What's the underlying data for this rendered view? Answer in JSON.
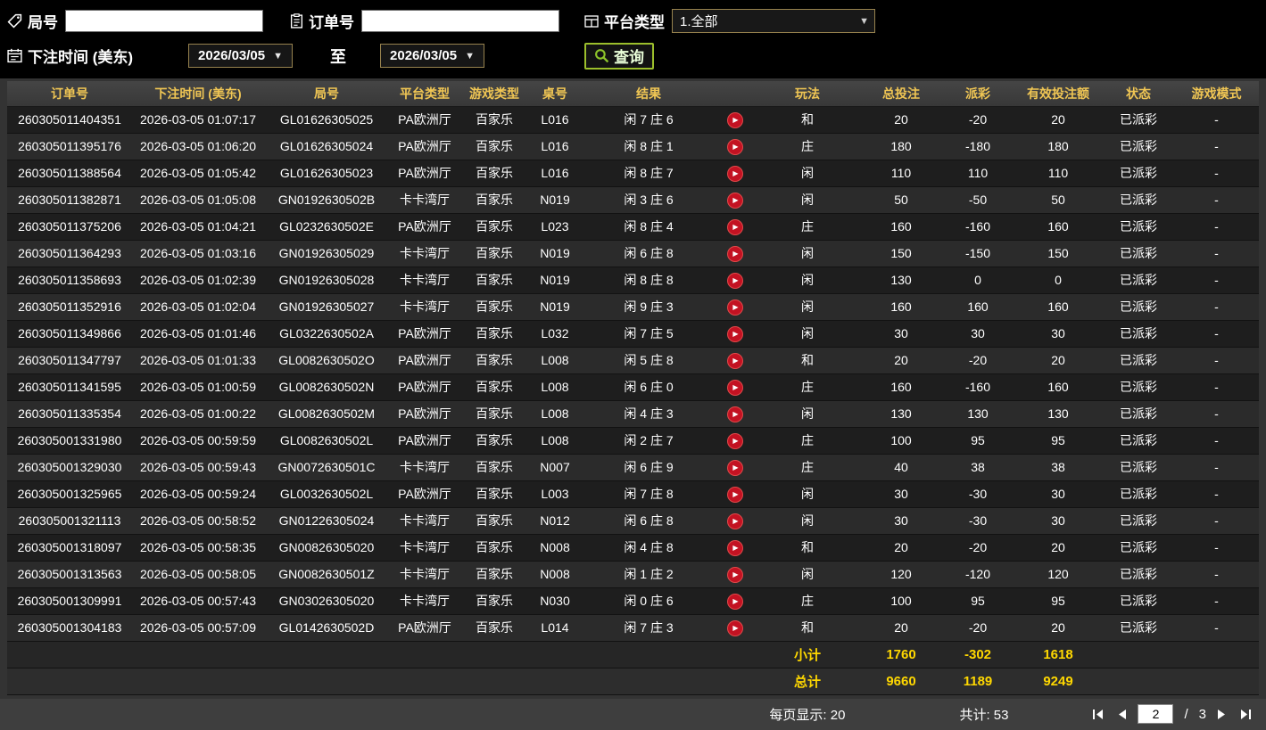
{
  "filters": {
    "round_label": "局号",
    "order_label": "订单号",
    "platform_label": "平台类型",
    "platform_value": "1.全部",
    "bet_time_label": "下注时间 (美东)",
    "date_from": "2026/03/05",
    "to_label": "至",
    "date_to": "2026/03/05",
    "search_label": "查询"
  },
  "table": {
    "headers": [
      "订单号",
      "下注时间 (美东)",
      "局号",
      "平台类型",
      "游戏类型",
      "桌号",
      "结果",
      "",
      "玩法",
      "总投注",
      "派彩",
      "有效投注额",
      "状态",
      "游戏模式"
    ],
    "rows": [
      {
        "order_no": "260305011404351",
        "bet_time": "2026-03-05 01:07:17",
        "round_no": "GL01626305025",
        "platform": "PA欧洲厅",
        "game_type": "百家乐",
        "table_no": "L016",
        "result": "闲 7 庄 6",
        "play": "和",
        "total_bet": "20",
        "payout": "-20",
        "valid_bet": "20",
        "status": "已派彩",
        "mode": "-"
      },
      {
        "order_no": "260305011395176",
        "bet_time": "2026-03-05 01:06:20",
        "round_no": "GL01626305024",
        "platform": "PA欧洲厅",
        "game_type": "百家乐",
        "table_no": "L016",
        "result": "闲 8 庄 1",
        "play": "庄",
        "total_bet": "180",
        "payout": "-180",
        "valid_bet": "180",
        "status": "已派彩",
        "mode": "-"
      },
      {
        "order_no": "260305011388564",
        "bet_time": "2026-03-05 01:05:42",
        "round_no": "GL01626305023",
        "platform": "PA欧洲厅",
        "game_type": "百家乐",
        "table_no": "L016",
        "result": "闲 8 庄 7",
        "play": "闲",
        "total_bet": "110",
        "payout": "110",
        "valid_bet": "110",
        "status": "已派彩",
        "mode": "-"
      },
      {
        "order_no": "260305011382871",
        "bet_time": "2026-03-05 01:05:08",
        "round_no": "GN0192630502B",
        "platform": "卡卡湾厅",
        "game_type": "百家乐",
        "table_no": "N019",
        "result": "闲 3 庄 6",
        "play": "闲",
        "total_bet": "50",
        "payout": "-50",
        "valid_bet": "50",
        "status": "已派彩",
        "mode": "-"
      },
      {
        "order_no": "260305011375206",
        "bet_time": "2026-03-05 01:04:21",
        "round_no": "GL0232630502E",
        "platform": "PA欧洲厅",
        "game_type": "百家乐",
        "table_no": "L023",
        "result": "闲 8 庄 4",
        "play": "庄",
        "total_bet": "160",
        "payout": "-160",
        "valid_bet": "160",
        "status": "已派彩",
        "mode": "-"
      },
      {
        "order_no": "260305011364293",
        "bet_time": "2026-03-05 01:03:16",
        "round_no": "GN01926305029",
        "platform": "卡卡湾厅",
        "game_type": "百家乐",
        "table_no": "N019",
        "result": "闲 6 庄 8",
        "play": "闲",
        "total_bet": "150",
        "payout": "-150",
        "valid_bet": "150",
        "status": "已派彩",
        "mode": "-"
      },
      {
        "order_no": "260305011358693",
        "bet_time": "2026-03-05 01:02:39",
        "round_no": "GN01926305028",
        "platform": "卡卡湾厅",
        "game_type": "百家乐",
        "table_no": "N019",
        "result": "闲 8 庄 8",
        "play": "闲",
        "total_bet": "130",
        "payout": "0",
        "valid_bet": "0",
        "status": "已派彩",
        "mode": "-"
      },
      {
        "order_no": "260305011352916",
        "bet_time": "2026-03-05 01:02:04",
        "round_no": "GN01926305027",
        "platform": "卡卡湾厅",
        "game_type": "百家乐",
        "table_no": "N019",
        "result": "闲 9 庄 3",
        "play": "闲",
        "total_bet": "160",
        "payout": "160",
        "valid_bet": "160",
        "status": "已派彩",
        "mode": "-"
      },
      {
        "order_no": "260305011349866",
        "bet_time": "2026-03-05 01:01:46",
        "round_no": "GL0322630502A",
        "platform": "PA欧洲厅",
        "game_type": "百家乐",
        "table_no": "L032",
        "result": "闲 7 庄 5",
        "play": "闲",
        "total_bet": "30",
        "payout": "30",
        "valid_bet": "30",
        "status": "已派彩",
        "mode": "-"
      },
      {
        "order_no": "260305011347797",
        "bet_time": "2026-03-05 01:01:33",
        "round_no": "GL0082630502O",
        "platform": "PA欧洲厅",
        "game_type": "百家乐",
        "table_no": "L008",
        "result": "闲 5 庄 8",
        "play": "和",
        "total_bet": "20",
        "payout": "-20",
        "valid_bet": "20",
        "status": "已派彩",
        "mode": "-"
      },
      {
        "order_no": "260305011341595",
        "bet_time": "2026-03-05 01:00:59",
        "round_no": "GL0082630502N",
        "platform": "PA欧洲厅",
        "game_type": "百家乐",
        "table_no": "L008",
        "result": "闲 6 庄 0",
        "play": "庄",
        "total_bet": "160",
        "payout": "-160",
        "valid_bet": "160",
        "status": "已派彩",
        "mode": "-"
      },
      {
        "order_no": "260305011335354",
        "bet_time": "2026-03-05 01:00:22",
        "round_no": "GL0082630502M",
        "platform": "PA欧洲厅",
        "game_type": "百家乐",
        "table_no": "L008",
        "result": "闲 4 庄 3",
        "play": "闲",
        "total_bet": "130",
        "payout": "130",
        "valid_bet": "130",
        "status": "已派彩",
        "mode": "-"
      },
      {
        "order_no": "260305001331980",
        "bet_time": "2026-03-05 00:59:59",
        "round_no": "GL0082630502L",
        "platform": "PA欧洲厅",
        "game_type": "百家乐",
        "table_no": "L008",
        "result": "闲 2 庄 7",
        "play": "庄",
        "total_bet": "100",
        "payout": "95",
        "valid_bet": "95",
        "status": "已派彩",
        "mode": "-"
      },
      {
        "order_no": "260305001329030",
        "bet_time": "2026-03-05 00:59:43",
        "round_no": "GN0072630501C",
        "platform": "卡卡湾厅",
        "game_type": "百家乐",
        "table_no": "N007",
        "result": "闲 6 庄 9",
        "play": "庄",
        "total_bet": "40",
        "payout": "38",
        "valid_bet": "38",
        "status": "已派彩",
        "mode": "-"
      },
      {
        "order_no": "260305001325965",
        "bet_time": "2026-03-05 00:59:24",
        "round_no": "GL0032630502L",
        "platform": "PA欧洲厅",
        "game_type": "百家乐",
        "table_no": "L003",
        "result": "闲 7 庄 8",
        "play": "闲",
        "total_bet": "30",
        "payout": "-30",
        "valid_bet": "30",
        "status": "已派彩",
        "mode": "-"
      },
      {
        "order_no": "260305001321113",
        "bet_time": "2026-03-05 00:58:52",
        "round_no": "GN01226305024",
        "platform": "卡卡湾厅",
        "game_type": "百家乐",
        "table_no": "N012",
        "result": "闲 6 庄 8",
        "play": "闲",
        "total_bet": "30",
        "payout": "-30",
        "valid_bet": "30",
        "status": "已派彩",
        "mode": "-"
      },
      {
        "order_no": "260305001318097",
        "bet_time": "2026-03-05 00:58:35",
        "round_no": "GN00826305020",
        "platform": "卡卡湾厅",
        "game_type": "百家乐",
        "table_no": "N008",
        "result": "闲 4 庄 8",
        "play": "和",
        "total_bet": "20",
        "payout": "-20",
        "valid_bet": "20",
        "status": "已派彩",
        "mode": "-"
      },
      {
        "order_no": "260305001313563",
        "bet_time": "2026-03-05 00:58:05",
        "round_no": "GN0082630501Z",
        "platform": "卡卡湾厅",
        "game_type": "百家乐",
        "table_no": "N008",
        "result": "闲 1 庄 2",
        "play": "闲",
        "total_bet": "120",
        "payout": "-120",
        "valid_bet": "120",
        "status": "已派彩",
        "mode": "-"
      },
      {
        "order_no": "260305001309991",
        "bet_time": "2026-03-05 00:57:43",
        "round_no": "GN03026305020",
        "platform": "卡卡湾厅",
        "game_type": "百家乐",
        "table_no": "N030",
        "result": "闲 0 庄 6",
        "play": "庄",
        "total_bet": "100",
        "payout": "95",
        "valid_bet": "95",
        "status": "已派彩",
        "mode": "-"
      },
      {
        "order_no": "260305001304183",
        "bet_time": "2026-03-05 00:57:09",
        "round_no": "GL0142630502D",
        "platform": "PA欧洲厅",
        "game_type": "百家乐",
        "table_no": "L014",
        "result": "闲 7 庄 3",
        "play": "和",
        "total_bet": "20",
        "payout": "-20",
        "valid_bet": "20",
        "status": "已派彩",
        "mode": "-"
      }
    ]
  },
  "summary": {
    "subtotal_label": "小计",
    "subtotal": [
      "1760",
      "-302",
      "1618"
    ],
    "total_label": "总计",
    "total": [
      "9660",
      "1189",
      "9249"
    ]
  },
  "pagination": {
    "per_page_label": "每页显示:",
    "per_page_value": "20",
    "total_label": "共计:",
    "total_value": "53",
    "current_page": "2",
    "separator": "/",
    "total_pages": "3"
  },
  "colors": {
    "payout_negative": "#00c800",
    "payout_positive": "#a81616",
    "status_green": "#27b52c",
    "header_gold": "#f0c654",
    "summary_yellow": "#ffd800"
  }
}
